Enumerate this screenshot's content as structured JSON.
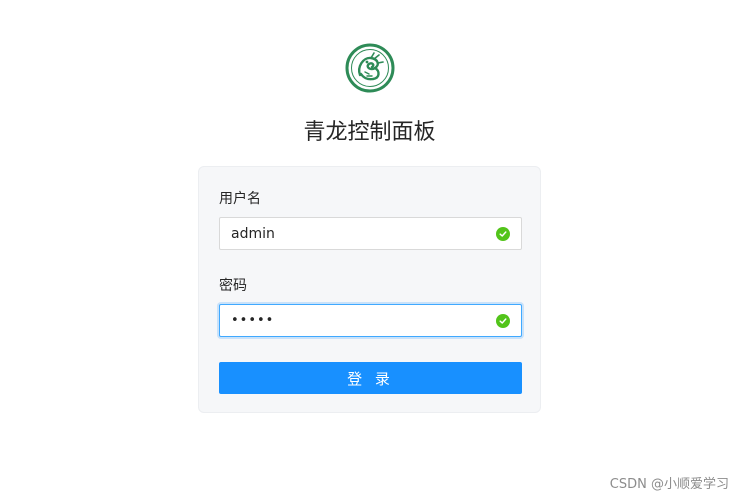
{
  "app": {
    "title": "青龙控制面板",
    "logo_icon": "qinglong-dragon-logo",
    "brand_color": "#2e8b57"
  },
  "login": {
    "username_label": "用户名",
    "username_value": "admin",
    "password_label": "密码",
    "password_value": "•••••",
    "submit_label": "登 录",
    "valid_icon": "check-circle-icon",
    "accent_color": "#1890ff",
    "valid_color": "#52c41a"
  },
  "watermark": {
    "text": "CSDN @小顺爱学习"
  }
}
